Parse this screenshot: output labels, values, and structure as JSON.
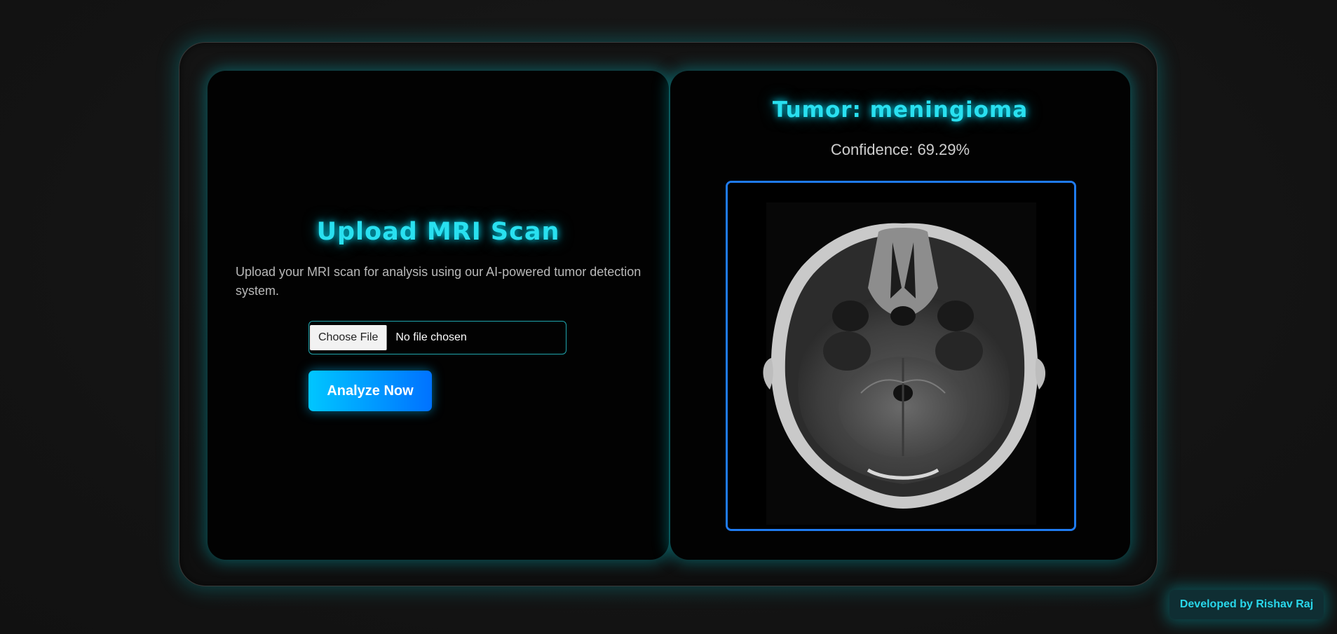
{
  "upload": {
    "title": "Upload MRI Scan",
    "description": "Upload your MRI scan for analysis using our AI-powered tumor detection system.",
    "choose_file_label": "Choose File",
    "file_status": "No file chosen",
    "analyze_label": "Analyze Now"
  },
  "result": {
    "title": "Tumor: meningioma",
    "confidence": "Confidence: 69.29%"
  },
  "footer": {
    "credit": "Developed by Rishav Raj"
  },
  "colors": {
    "accent_cyan": "#29e0f0",
    "button_gradient_start": "#00c6ff",
    "button_gradient_end": "#0072ff",
    "image_border": "#1f7bf0",
    "panel_bg": "#020202",
    "page_bg": "#141414"
  }
}
